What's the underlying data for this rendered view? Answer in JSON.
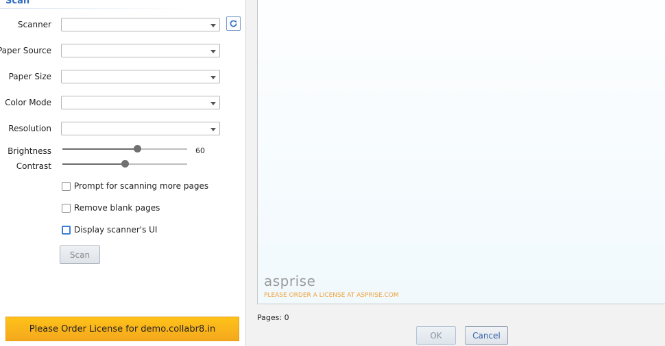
{
  "section": {
    "title": "Scan"
  },
  "fields": {
    "scanner": {
      "label": "Scanner",
      "value": ""
    },
    "paper_source": {
      "label": "Paper Source",
      "value": ""
    },
    "paper_size": {
      "label": "Paper Size",
      "value": ""
    },
    "color_mode": {
      "label": "Color Mode",
      "value": ""
    },
    "resolution": {
      "label": "Resolution",
      "value": ""
    }
  },
  "sliders": {
    "brightness": {
      "label": "Brightness",
      "value": 60,
      "display": "60",
      "min": 0,
      "max": 100
    },
    "contrast": {
      "label": "Contrast",
      "value": 50,
      "min": 0,
      "max": 100
    }
  },
  "options": {
    "prompt_more": {
      "label": "Prompt for scanning more pages",
      "checked": false
    },
    "remove_blank": {
      "label": "Remove blank pages",
      "checked": false
    },
    "display_ui": {
      "label": "Display scanner's UI",
      "checked": false
    }
  },
  "buttons": {
    "scan": "Scan",
    "ok": "OK",
    "cancel": "Cancel"
  },
  "license_bar": {
    "text": "Please Order License for demo.collabr8.in"
  },
  "preview": {
    "brand": "asprise",
    "license_note": "PLEASE ORDER A LICENSE AT ASPRISE.COM"
  },
  "status": {
    "pages": "Pages: 0"
  },
  "colors": {
    "accent": "#2f6bbd",
    "license_bar": "#ffc21a",
    "note": "#f0a13a"
  },
  "icons": {
    "refresh": "refresh-icon"
  }
}
